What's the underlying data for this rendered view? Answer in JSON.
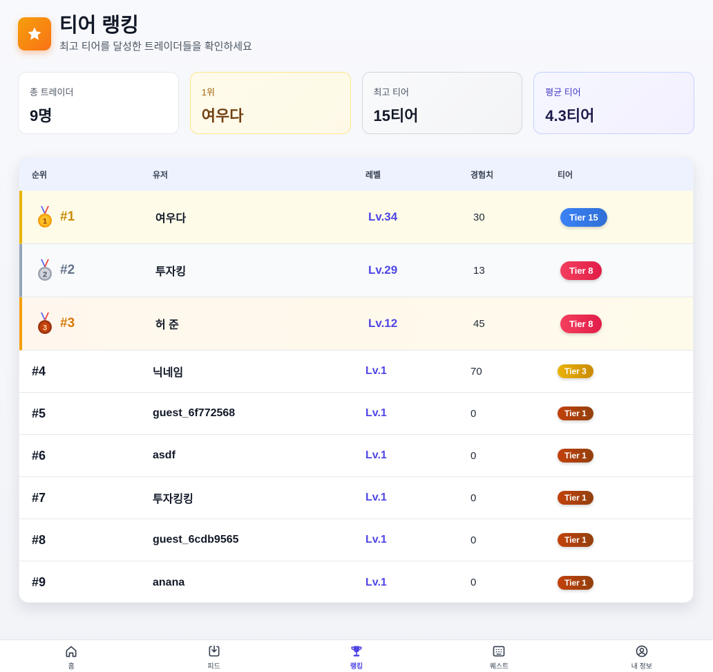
{
  "header": {
    "title": "티어 랭킹",
    "subtitle": "최고 티어를 달성한 트레이더들을 확인하세요",
    "logo_icon": "star-icon"
  },
  "stats": [
    {
      "label": "총 트레이더",
      "value": "9명"
    },
    {
      "label": "1위",
      "value": "여우다"
    },
    {
      "label": "최고 티어",
      "value": "15티어"
    },
    {
      "label": "평균 티어",
      "value": "4.3티어"
    }
  ],
  "table": {
    "headers": {
      "rank": "순위",
      "user": "유저",
      "level": "레벨",
      "xp": "경험치",
      "tier": "티어"
    },
    "rows": [
      {
        "rank": "#1",
        "user": "여우다",
        "level": "Lv.34",
        "xp": "30",
        "tier": "Tier 15",
        "medal": "gold-medal-icon"
      },
      {
        "rank": "#2",
        "user": "투자킹",
        "level": "Lv.29",
        "xp": "13",
        "tier": "Tier 8",
        "medal": "silver-medal-icon"
      },
      {
        "rank": "#3",
        "user": "허 준",
        "level": "Lv.12",
        "xp": "45",
        "tier": "Tier 8",
        "medal": "bronze-medal-icon"
      },
      {
        "rank": "#4",
        "user": "닉네임",
        "level": "Lv.1",
        "xp": "70",
        "tier": "Tier 3"
      },
      {
        "rank": "#5",
        "user": "guest_6f772568",
        "level": "Lv.1",
        "xp": "0",
        "tier": "Tier 1"
      },
      {
        "rank": "#6",
        "user": "asdf",
        "level": "Lv.1",
        "xp": "0",
        "tier": "Tier 1"
      },
      {
        "rank": "#7",
        "user": "투자킹킹",
        "level": "Lv.1",
        "xp": "0",
        "tier": "Tier 1"
      },
      {
        "rank": "#8",
        "user": "guest_6cdb9565",
        "level": "Lv.1",
        "xp": "0",
        "tier": "Tier 1"
      },
      {
        "rank": "#9",
        "user": "anana",
        "level": "Lv.1",
        "xp": "0",
        "tier": "Tier 1"
      }
    ]
  },
  "nav": {
    "items": [
      {
        "label": "홈",
        "icon": "home-icon"
      },
      {
        "label": "피드",
        "icon": "feed-icon"
      },
      {
        "label": "랭킹",
        "icon": "trophy-icon",
        "active": true
      },
      {
        "label": "퀘스트",
        "icon": "quest-icon"
      },
      {
        "label": "내 정보",
        "icon": "profile-icon"
      }
    ]
  },
  "colors": {
    "accent": "#4f46e5",
    "gold": "#eab308",
    "silver": "#94a3b8",
    "bronze": "#f59e0b"
  }
}
